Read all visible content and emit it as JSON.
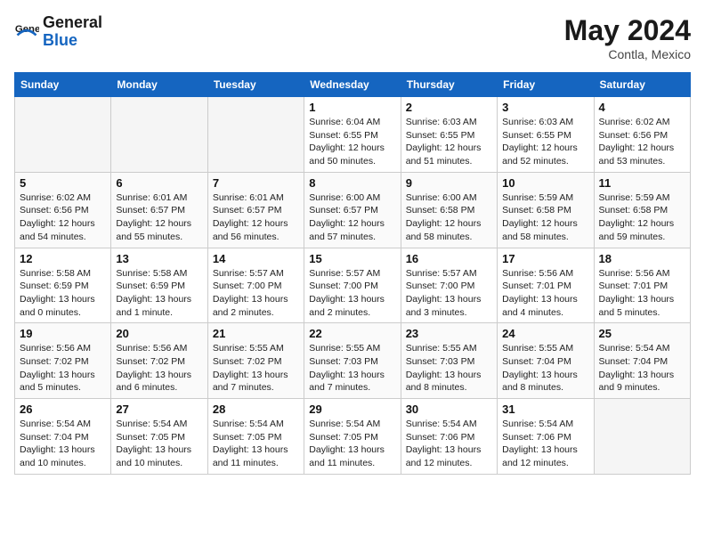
{
  "header": {
    "logo_general": "General",
    "logo_blue": "Blue",
    "month_year": "May 2024",
    "location": "Contla, Mexico"
  },
  "weekdays": [
    "Sunday",
    "Monday",
    "Tuesday",
    "Wednesday",
    "Thursday",
    "Friday",
    "Saturday"
  ],
  "weeks": [
    [
      {
        "day": "",
        "empty": true
      },
      {
        "day": "",
        "empty": true
      },
      {
        "day": "",
        "empty": true
      },
      {
        "day": "1",
        "sunrise": "Sunrise: 6:04 AM",
        "sunset": "Sunset: 6:55 PM",
        "daylight": "Daylight: 12 hours and 50 minutes."
      },
      {
        "day": "2",
        "sunrise": "Sunrise: 6:03 AM",
        "sunset": "Sunset: 6:55 PM",
        "daylight": "Daylight: 12 hours and 51 minutes."
      },
      {
        "day": "3",
        "sunrise": "Sunrise: 6:03 AM",
        "sunset": "Sunset: 6:55 PM",
        "daylight": "Daylight: 12 hours and 52 minutes."
      },
      {
        "day": "4",
        "sunrise": "Sunrise: 6:02 AM",
        "sunset": "Sunset: 6:56 PM",
        "daylight": "Daylight: 12 hours and 53 minutes."
      }
    ],
    [
      {
        "day": "5",
        "sunrise": "Sunrise: 6:02 AM",
        "sunset": "Sunset: 6:56 PM",
        "daylight": "Daylight: 12 hours and 54 minutes."
      },
      {
        "day": "6",
        "sunrise": "Sunrise: 6:01 AM",
        "sunset": "Sunset: 6:57 PM",
        "daylight": "Daylight: 12 hours and 55 minutes."
      },
      {
        "day": "7",
        "sunrise": "Sunrise: 6:01 AM",
        "sunset": "Sunset: 6:57 PM",
        "daylight": "Daylight: 12 hours and 56 minutes."
      },
      {
        "day": "8",
        "sunrise": "Sunrise: 6:00 AM",
        "sunset": "Sunset: 6:57 PM",
        "daylight": "Daylight: 12 hours and 57 minutes."
      },
      {
        "day": "9",
        "sunrise": "Sunrise: 6:00 AM",
        "sunset": "Sunset: 6:58 PM",
        "daylight": "Daylight: 12 hours and 58 minutes."
      },
      {
        "day": "10",
        "sunrise": "Sunrise: 5:59 AM",
        "sunset": "Sunset: 6:58 PM",
        "daylight": "Daylight: 12 hours and 58 minutes."
      },
      {
        "day": "11",
        "sunrise": "Sunrise: 5:59 AM",
        "sunset": "Sunset: 6:58 PM",
        "daylight": "Daylight: 12 hours and 59 minutes."
      }
    ],
    [
      {
        "day": "12",
        "sunrise": "Sunrise: 5:58 AM",
        "sunset": "Sunset: 6:59 PM",
        "daylight": "Daylight: 13 hours and 0 minutes."
      },
      {
        "day": "13",
        "sunrise": "Sunrise: 5:58 AM",
        "sunset": "Sunset: 6:59 PM",
        "daylight": "Daylight: 13 hours and 1 minute."
      },
      {
        "day": "14",
        "sunrise": "Sunrise: 5:57 AM",
        "sunset": "Sunset: 7:00 PM",
        "daylight": "Daylight: 13 hours and 2 minutes."
      },
      {
        "day": "15",
        "sunrise": "Sunrise: 5:57 AM",
        "sunset": "Sunset: 7:00 PM",
        "daylight": "Daylight: 13 hours and 2 minutes."
      },
      {
        "day": "16",
        "sunrise": "Sunrise: 5:57 AM",
        "sunset": "Sunset: 7:00 PM",
        "daylight": "Daylight: 13 hours and 3 minutes."
      },
      {
        "day": "17",
        "sunrise": "Sunrise: 5:56 AM",
        "sunset": "Sunset: 7:01 PM",
        "daylight": "Daylight: 13 hours and 4 minutes."
      },
      {
        "day": "18",
        "sunrise": "Sunrise: 5:56 AM",
        "sunset": "Sunset: 7:01 PM",
        "daylight": "Daylight: 13 hours and 5 minutes."
      }
    ],
    [
      {
        "day": "19",
        "sunrise": "Sunrise: 5:56 AM",
        "sunset": "Sunset: 7:02 PM",
        "daylight": "Daylight: 13 hours and 5 minutes."
      },
      {
        "day": "20",
        "sunrise": "Sunrise: 5:56 AM",
        "sunset": "Sunset: 7:02 PM",
        "daylight": "Daylight: 13 hours and 6 minutes."
      },
      {
        "day": "21",
        "sunrise": "Sunrise: 5:55 AM",
        "sunset": "Sunset: 7:02 PM",
        "daylight": "Daylight: 13 hours and 7 minutes."
      },
      {
        "day": "22",
        "sunrise": "Sunrise: 5:55 AM",
        "sunset": "Sunset: 7:03 PM",
        "daylight": "Daylight: 13 hours and 7 minutes."
      },
      {
        "day": "23",
        "sunrise": "Sunrise: 5:55 AM",
        "sunset": "Sunset: 7:03 PM",
        "daylight": "Daylight: 13 hours and 8 minutes."
      },
      {
        "day": "24",
        "sunrise": "Sunrise: 5:55 AM",
        "sunset": "Sunset: 7:04 PM",
        "daylight": "Daylight: 13 hours and 8 minutes."
      },
      {
        "day": "25",
        "sunrise": "Sunrise: 5:54 AM",
        "sunset": "Sunset: 7:04 PM",
        "daylight": "Daylight: 13 hours and 9 minutes."
      }
    ],
    [
      {
        "day": "26",
        "sunrise": "Sunrise: 5:54 AM",
        "sunset": "Sunset: 7:04 PM",
        "daylight": "Daylight: 13 hours and 10 minutes."
      },
      {
        "day": "27",
        "sunrise": "Sunrise: 5:54 AM",
        "sunset": "Sunset: 7:05 PM",
        "daylight": "Daylight: 13 hours and 10 minutes."
      },
      {
        "day": "28",
        "sunrise": "Sunrise: 5:54 AM",
        "sunset": "Sunset: 7:05 PM",
        "daylight": "Daylight: 13 hours and 11 minutes."
      },
      {
        "day": "29",
        "sunrise": "Sunrise: 5:54 AM",
        "sunset": "Sunset: 7:05 PM",
        "daylight": "Daylight: 13 hours and 11 minutes."
      },
      {
        "day": "30",
        "sunrise": "Sunrise: 5:54 AM",
        "sunset": "Sunset: 7:06 PM",
        "daylight": "Daylight: 13 hours and 12 minutes."
      },
      {
        "day": "31",
        "sunrise": "Sunrise: 5:54 AM",
        "sunset": "Sunset: 7:06 PM",
        "daylight": "Daylight: 13 hours and 12 minutes."
      },
      {
        "day": "",
        "empty": true
      }
    ]
  ]
}
